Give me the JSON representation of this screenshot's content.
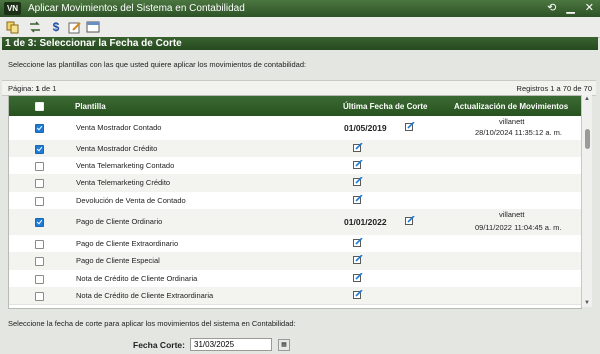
{
  "window": {
    "logo": "VN",
    "title": "Aplicar Movimientos del Sistema en Contabilidad"
  },
  "toolbar": {
    "icons": [
      "duplicate-icon",
      "switch-icon",
      "dollar-icon",
      "edit-icon",
      "window-icon"
    ]
  },
  "step": {
    "title": "1 de 3: Seleccionar la Fecha de Corte"
  },
  "instructions": "Seleccione las plantillas con las que usted quiere aplicar los movimientos de contabilidad:",
  "paging": {
    "page_prefix": "Página: ",
    "page_num": "1",
    "page_suffix": " de 1",
    "records": "Registros 1 a 70 de 70"
  },
  "grid": {
    "columns": [
      "Plantilla",
      "Última Fecha de Corte",
      "Actualización de Movimientos"
    ],
    "rows": [
      {
        "checked": true,
        "plantilla": "Venta Mostrador Contado",
        "fecha": "01/05/2019",
        "user": "villanett",
        "updated": "28/10/2024 11:35:12 a. m."
      },
      {
        "checked": true,
        "plantilla": "Venta Mostrador Crédito",
        "fecha": "",
        "user": "",
        "updated": ""
      },
      {
        "checked": false,
        "plantilla": "Venta Telemarketing Contado",
        "fecha": "",
        "user": "",
        "updated": ""
      },
      {
        "checked": false,
        "plantilla": "Venta Telemarketing Crédito",
        "fecha": "",
        "user": "",
        "updated": ""
      },
      {
        "checked": false,
        "plantilla": "Devolución de Venta de Contado",
        "fecha": "",
        "user": "",
        "updated": ""
      },
      {
        "checked": true,
        "plantilla": "Pago de Cliente Ordinario",
        "fecha": "01/01/2022",
        "user": "villanett",
        "updated": "09/11/2022 11:04:45 a. m."
      },
      {
        "checked": false,
        "plantilla": "Pago de Cliente Extraordinario",
        "fecha": "",
        "user": "",
        "updated": ""
      },
      {
        "checked": false,
        "plantilla": "Pago de Cliente Especial",
        "fecha": "",
        "user": "",
        "updated": ""
      },
      {
        "checked": false,
        "plantilla": "Nota de Crédito de Cliente Ordinaria",
        "fecha": "",
        "user": "",
        "updated": ""
      },
      {
        "checked": false,
        "plantilla": "Nota de Crédito de Cliente Extraordinaria",
        "fecha": "",
        "user": "",
        "updated": ""
      }
    ]
  },
  "footer": {
    "instructions": "Seleccione la fecha de corte para aplicar los movimientos del sistema en Contabilidad:",
    "label": "Fecha Corte:",
    "value": "31/03/2025"
  },
  "colors": {
    "title_green": "#2c5226",
    "header_green": "#27521f",
    "check_blue": "#1e7bd6"
  }
}
